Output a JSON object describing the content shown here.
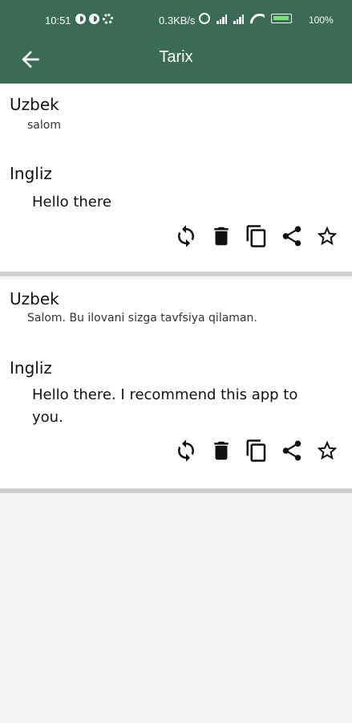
{
  "status_bar": {
    "time": "10:51",
    "speed": "0.3KB/s",
    "battery": "100%"
  },
  "app_bar": {
    "title": "Tarix"
  },
  "history": [
    {
      "source_lang": "Uzbek",
      "source_text": "salom",
      "target_lang": "Ingliz",
      "target_text": "Hello there"
    },
    {
      "source_lang": "Uzbek",
      "source_text": "Salom. Bu ilovani sizga tavfsiya qilaman.",
      "target_lang": "Ingliz",
      "target_text": "Hello there. I recommend this app to you."
    }
  ],
  "icons": {
    "back": "arrow-left-icon",
    "reverse": "refresh-icon",
    "delete": "trash-icon",
    "copy": "copy-icon",
    "share": "share-icon",
    "favorite": "star-outline-icon"
  },
  "colors": {
    "app_bar": "#3a6b56",
    "divider": "#cfcfcf",
    "background": "#f4f4f4"
  }
}
